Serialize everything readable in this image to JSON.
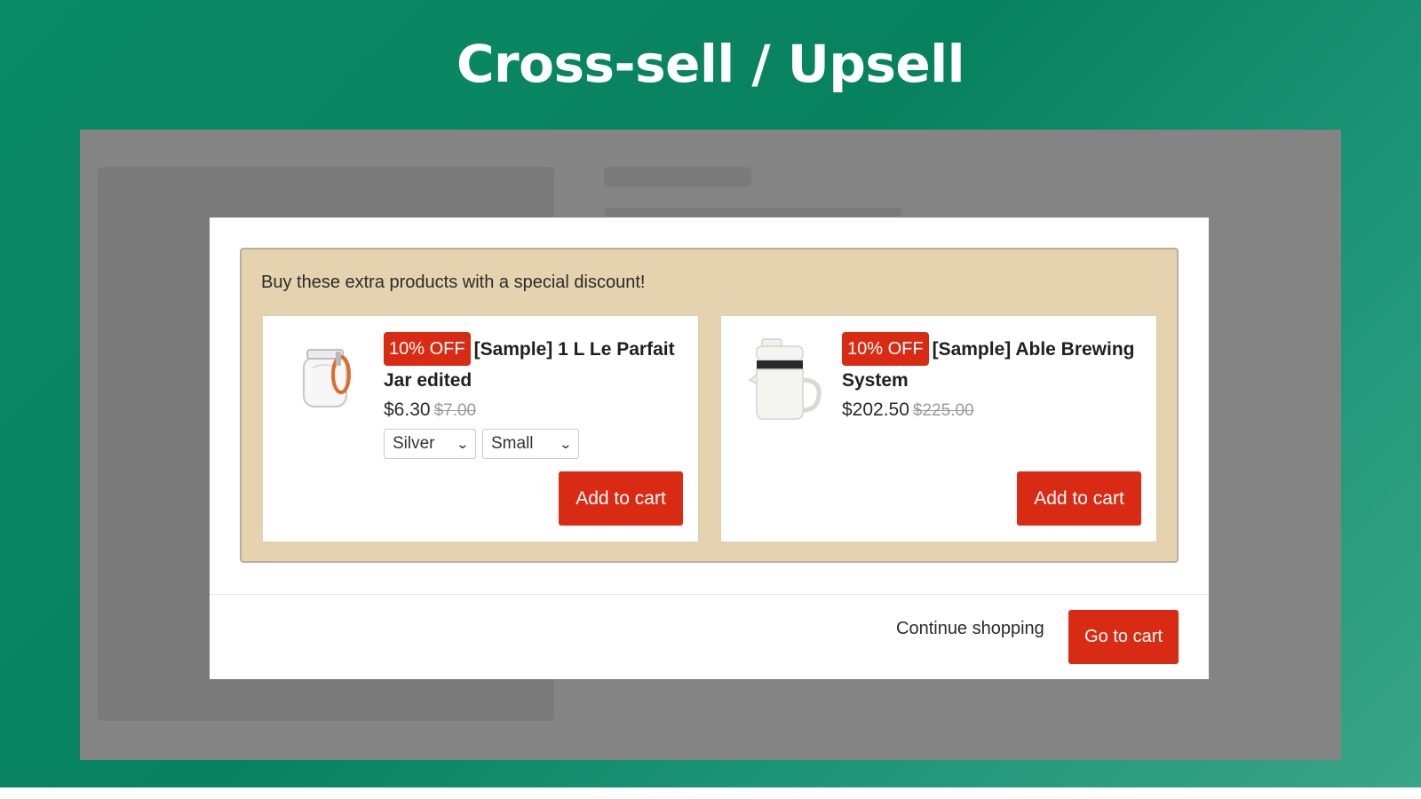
{
  "page": {
    "title": "Cross-sell / Upsell"
  },
  "offer": {
    "heading": "Buy these extra products with a special discount!",
    "products": [
      {
        "badge": "10% OFF",
        "name": "[Sample] 1 L Le Parfait Jar edited",
        "price": "$6.30",
        "old_price": "$7.00",
        "image_icon": "glass-jar-icon",
        "options": {
          "color": "Silver",
          "size": "Small"
        },
        "add_label": "Add to cart"
      },
      {
        "badge": "10% OFF",
        "name": "[Sample] Able Brewing System",
        "price": "$202.50",
        "old_price": "$225.00",
        "image_icon": "brewing-pitcher-icon",
        "add_label": "Add to cart"
      }
    ]
  },
  "footer": {
    "continue_label": "Continue shopping",
    "go_to_cart_label": "Go to cart"
  },
  "colors": {
    "accent": "#d92b14",
    "offer_background": "#e4d3ae",
    "backdrop": "#848484",
    "page_background": "#07825e"
  }
}
